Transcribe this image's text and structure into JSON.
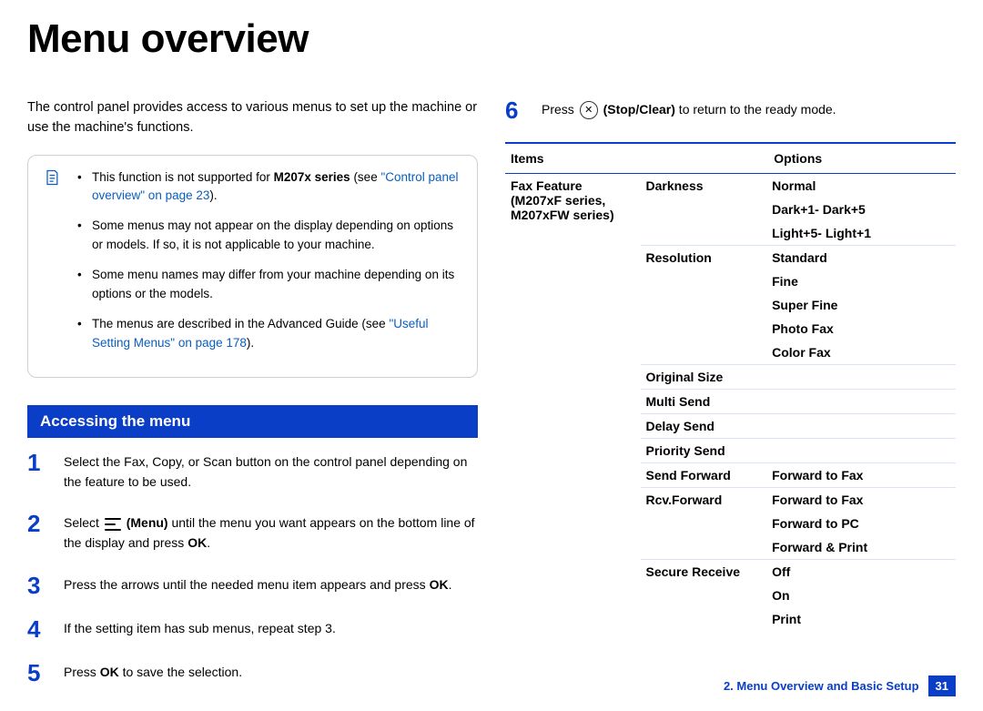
{
  "title": "Menu overview",
  "intro": "The control panel provides access to various menus to set up the machine or use the machine's functions.",
  "notes": [
    {
      "pre": "This function is not supported for ",
      "bold": "M207x series",
      "post": " (see ",
      "link": "\"Control panel overview\" on page 23",
      "post2": ")."
    },
    {
      "text": "Some menus may not appear on the display depending on options or models. If so, it is not applicable to your machine."
    },
    {
      "text": "Some menu names may differ from your machine depending on its options or the models."
    },
    {
      "pre": "The menus are described in the Advanced Guide (see ",
      "link": "\"Useful Setting Menus\" on page 178",
      "post2": ")."
    }
  ],
  "section_heading": "Accessing the menu",
  "steps": [
    {
      "n": "1",
      "text": "Select the Fax, Copy, or Scan button on the control panel depending on the feature to be used."
    },
    {
      "n": "2",
      "pre": "Select ",
      "icon": "menu",
      "bold": " (Menu)",
      "post": " until the menu you want appears on the bottom line of the display and press ",
      "bold2": "OK",
      "post2": "."
    },
    {
      "n": "3",
      "pre": "Press the arrows until the needed menu item appears and press ",
      "bold": "OK",
      "post": "."
    },
    {
      "n": "4",
      "text": "If the setting item has sub menus, repeat step 3."
    },
    {
      "n": "5",
      "pre": "Press ",
      "bold": "OK",
      "post": " to save the selection."
    },
    {
      "n": "6",
      "pre": "Press ",
      "icon": "stop",
      "bold": " (Stop/Clear)",
      "post": " to return to the ready mode."
    }
  ],
  "table": {
    "headers": {
      "c1": "Items",
      "c2": "Options"
    },
    "group_label_lines": [
      "Fax Feature",
      "(M207xF series,",
      "M207xFW series)"
    ],
    "rows": [
      {
        "sub": "Darkness",
        "opts": [
          "Normal",
          "Dark+1- Dark+5",
          "Light+5- Light+1"
        ]
      },
      {
        "sub": "Resolution",
        "opts": [
          "Standard",
          "Fine",
          "Super Fine",
          "Photo Fax",
          "Color Fax"
        ]
      },
      {
        "sub": "Original Size",
        "opts": []
      },
      {
        "sub": "Multi Send",
        "opts": []
      },
      {
        "sub": "Delay Send",
        "opts": []
      },
      {
        "sub": "Priority Send",
        "opts": []
      },
      {
        "sub": "Send Forward",
        "opts": [
          "Forward to Fax"
        ]
      },
      {
        "sub": "Rcv.Forward",
        "opts": [
          "Forward to Fax",
          "Forward to PC",
          "Forward & Print"
        ]
      },
      {
        "sub": "Secure Receive",
        "opts": [
          "Off",
          "On",
          "Print"
        ]
      }
    ]
  },
  "footer": {
    "chapter": "2. Menu Overview and Basic Setup",
    "page": "31"
  }
}
